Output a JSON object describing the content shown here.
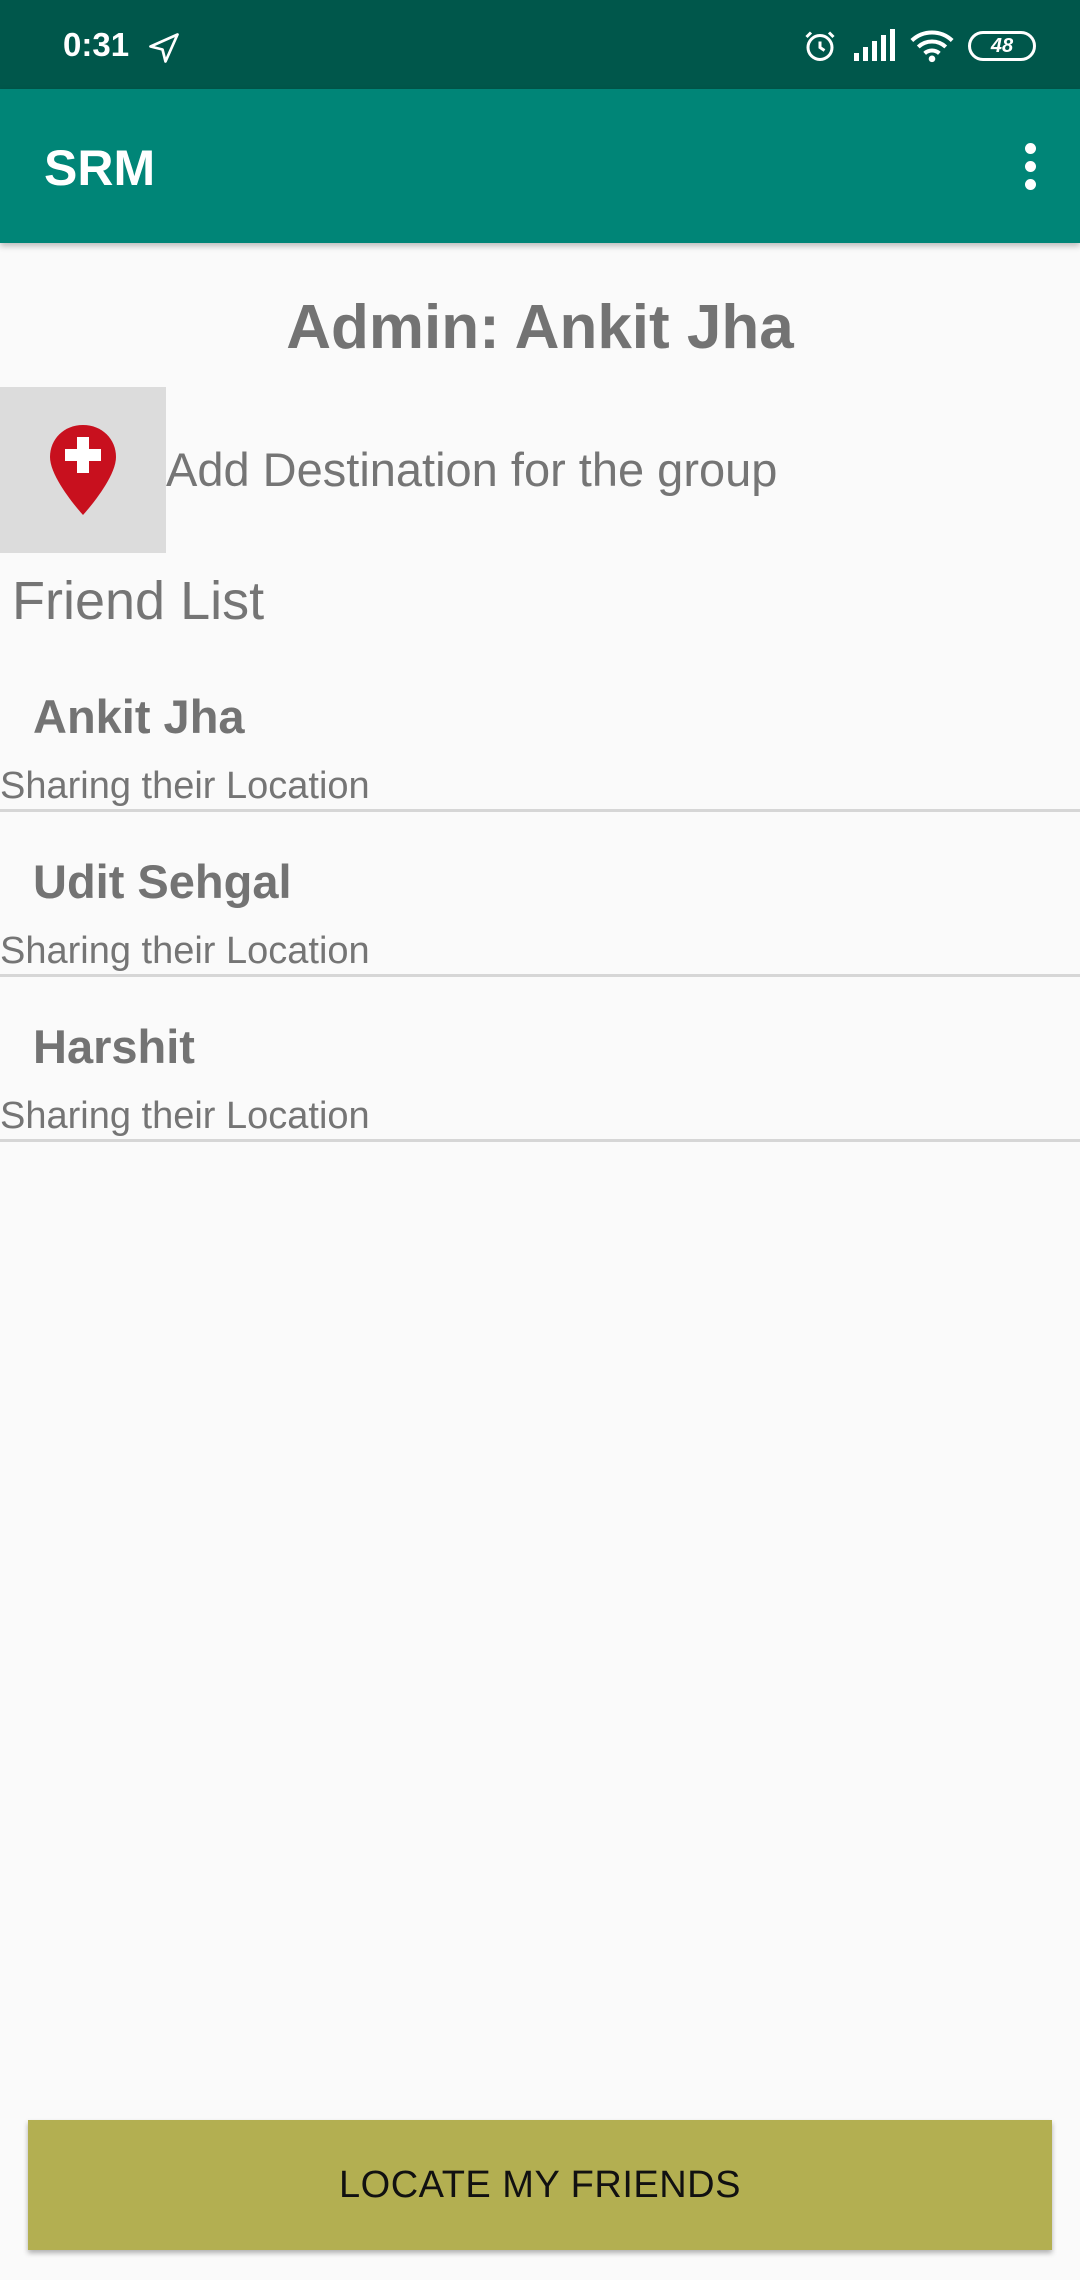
{
  "status_bar": {
    "time": "0:31",
    "battery": "48",
    "icons": [
      "navigation-arrow-icon",
      "alarm-icon",
      "signal-icon",
      "wifi-icon",
      "battery-icon"
    ]
  },
  "app_bar": {
    "title": "SRM",
    "overflow_icon": "more-vert-icon"
  },
  "main": {
    "admin_title": "Admin: Ankit Jha",
    "destination_label": "Add Destination for the group",
    "destination_icon": "add-location-pin-icon",
    "friend_list_title": "Friend List",
    "friends": [
      {
        "name": "Ankit Jha",
        "status": "Sharing their Location"
      },
      {
        "name": "Udit Sehgal",
        "status": "Sharing their Location"
      },
      {
        "name": "Harshit",
        "status": "Sharing their Location"
      }
    ]
  },
  "footer": {
    "locate_button": "LOCATE MY FRIENDS"
  },
  "colors": {
    "status_bar": "#00574b",
    "app_bar": "#008577",
    "button": "#b3af51",
    "pin": "#c8101e"
  }
}
